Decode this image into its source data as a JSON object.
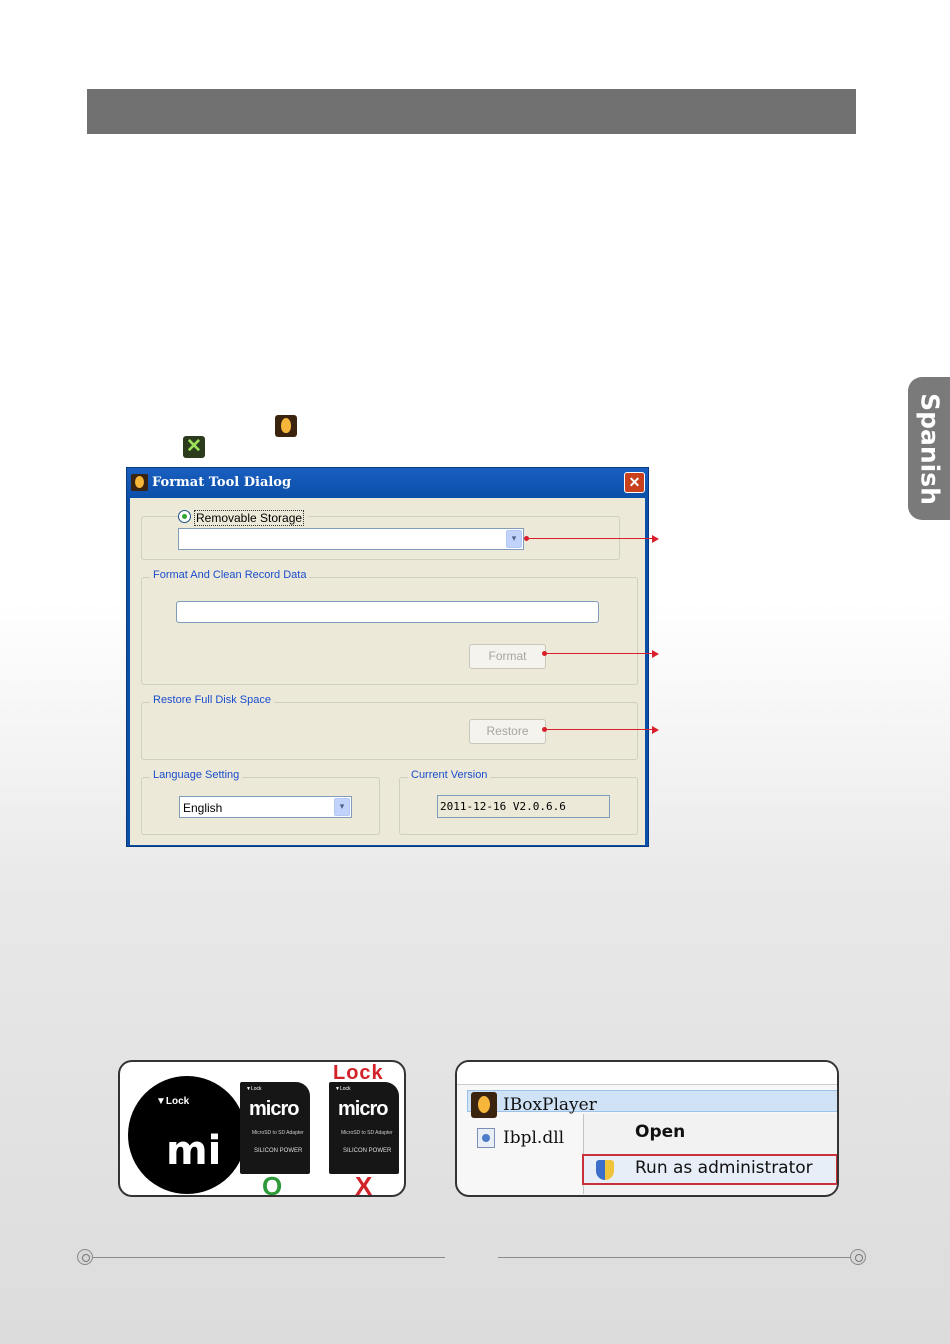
{
  "side_tab": {
    "label": "Spanish"
  },
  "dialog": {
    "title": "Format Tool Dialog",
    "close_glyph": "✕",
    "storage": {
      "radio_label": "Removable Storage",
      "selected": true,
      "combo_value": ""
    },
    "format_group": {
      "legend": "Format And Clean Record Data",
      "progress_value": "",
      "button_label": "Format"
    },
    "restore_group": {
      "legend": "Restore Full Disk Space",
      "button_label": "Restore"
    },
    "language_group": {
      "legend": "Language Setting",
      "selected": "English"
    },
    "version_group": {
      "legend": "Current Version",
      "value": "2011-12-16 V2.0.6.6"
    },
    "combo_arrow_glyph": "▾"
  },
  "inline_icons": [
    "iboxplayer-app-icon",
    "format-tool-icon"
  ],
  "format_tool_icon_glyph": "✕",
  "sd_panel": {
    "zoom_lock": "▼Lock",
    "zoom_text": "mi",
    "lock_label": "Lock",
    "ok_mark": "O",
    "bad_mark": "X",
    "card_lock": "▼Lock",
    "card_logo": "micro",
    "card_sub": "MicroSD to SD Adapter",
    "card_brand": "SILICON POWER"
  },
  "context_panel": {
    "app_name": "IBoxPlayer",
    "dll_name": "Ibpl.dll",
    "menu_open": "Open",
    "menu_run_admin": "Run as administrator"
  },
  "colors": {
    "header_bar": "#717171",
    "side_tab": "#7a7a7a",
    "callout": "#d9202a",
    "dialog_frame": "#0a4fa8",
    "dialog_client": "#ece9d8",
    "group_legend": "#1a4dcc"
  }
}
